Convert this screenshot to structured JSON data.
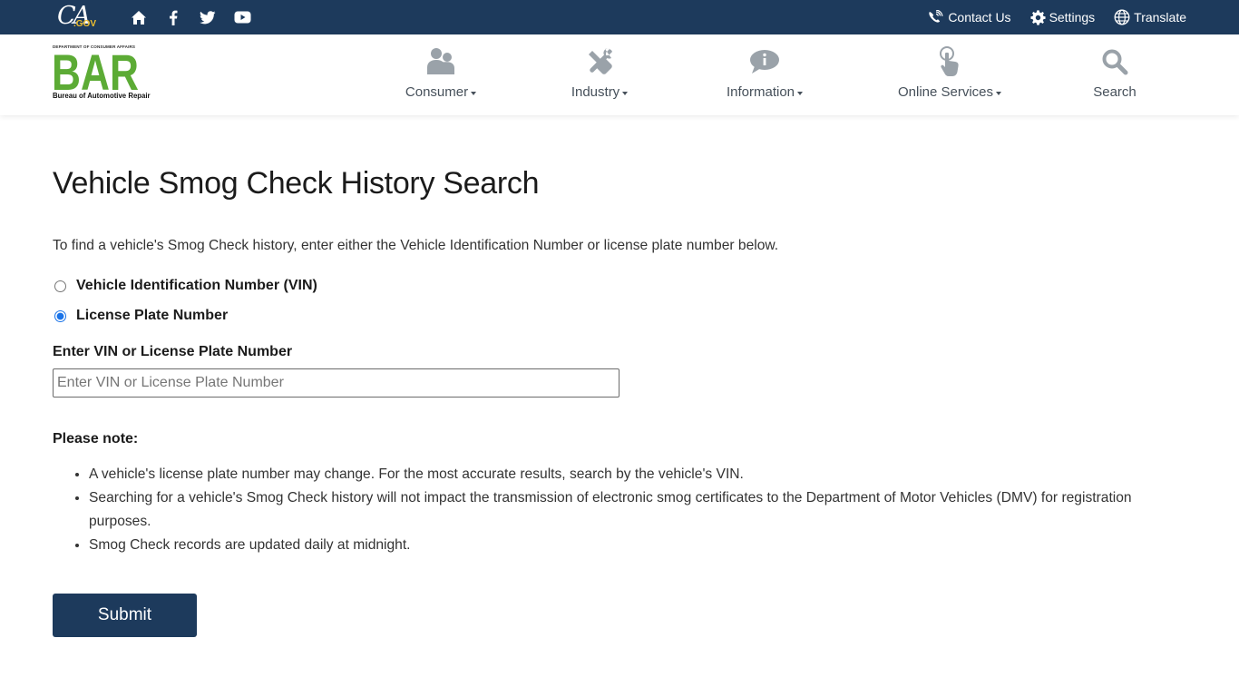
{
  "utility_bar": {
    "logo_ca": "CA",
    "logo_gov": ".GOV",
    "icons": [
      "home-icon",
      "facebook-icon",
      "twitter-icon",
      "youtube-icon"
    ],
    "contact_label": "Contact Us",
    "settings_label": "Settings",
    "translate_label": "Translate"
  },
  "header": {
    "logo_department": "DEPARTMENT OF CONSUMER AFFAIRS",
    "logo_letters": "BAR",
    "logo_bureau": "Bureau of Automotive Repair"
  },
  "nav": {
    "items": [
      {
        "label": "Consumer",
        "icon": "people-icon",
        "has_dropdown": true
      },
      {
        "label": "Industry",
        "icon": "tools-icon",
        "has_dropdown": true
      },
      {
        "label": "Information",
        "icon": "info-bubble-icon",
        "has_dropdown": true
      },
      {
        "label": "Online Services",
        "icon": "pointer-hand-icon",
        "has_dropdown": true
      },
      {
        "label": "Search",
        "icon": "search-icon",
        "has_dropdown": false
      }
    ]
  },
  "main": {
    "title": "Vehicle Smog Check History Search",
    "intro": "To find a vehicle's Smog Check history, enter either the Vehicle Identification Number or license plate number below.",
    "radio_options": [
      {
        "label": "Vehicle Identification Number (VIN)",
        "checked": false
      },
      {
        "label": "License Plate Number",
        "checked": true
      }
    ],
    "field_label": "Enter VIN or License Plate Number",
    "field_placeholder": "Enter VIN or License Plate Number",
    "field_value": "",
    "note_heading": "Please note:",
    "notes": [
      "A vehicle's license plate number may change. For the most accurate results, search by the vehicle's VIN.",
      "Searching for a vehicle's Smog Check history will not impact the transmission of electronic smog certificates to the Department of Motor Vehicles (DMV) for registration purposes.",
      "Smog Check records are updated daily at midnight."
    ],
    "submit_label": "Submit"
  },
  "colors": {
    "brand_navy": "#1d3a5c",
    "logo_green": "#5cab35",
    "nav_icon_gray": "#9aa2a9",
    "radio_accent": "#1a73e8"
  }
}
